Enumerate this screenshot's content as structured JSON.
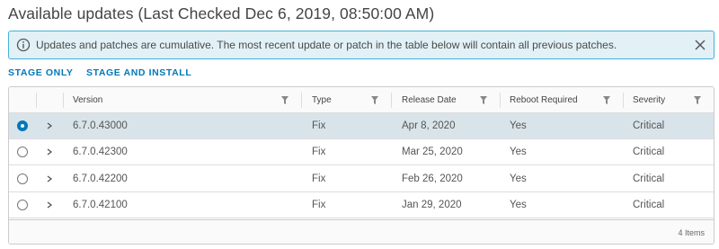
{
  "title": "Available updates (Last Checked Dec 6, 2019, 08:50:00 AM)",
  "alert": {
    "message": "Updates and patches are cumulative. The most recent update or patch in the table below will contain all previous patches.",
    "icon": "info-icon",
    "close_icon": "close-icon"
  },
  "actions": {
    "stage_only": "STAGE ONLY",
    "stage_and_install": "STAGE AND INSTALL"
  },
  "table": {
    "columns": [
      "Version",
      "Type",
      "Release Date",
      "Reboot Required",
      "Severity"
    ],
    "rows": [
      {
        "version": "6.7.0.43000",
        "type": "Fix",
        "release_date": "Apr 8, 2020",
        "reboot": "Yes",
        "severity": "Critical",
        "selected": true
      },
      {
        "version": "6.7.0.42300",
        "type": "Fix",
        "release_date": "Mar 25, 2020",
        "reboot": "Yes",
        "severity": "Critical",
        "selected": false
      },
      {
        "version": "6.7.0.42200",
        "type": "Fix",
        "release_date": "Feb 26, 2020",
        "reboot": "Yes",
        "severity": "Critical",
        "selected": false
      },
      {
        "version": "6.7.0.42100",
        "type": "Fix",
        "release_date": "Jan 29, 2020",
        "reboot": "Yes",
        "severity": "Critical",
        "selected": false
      }
    ],
    "footer": "4 Items"
  },
  "colors": {
    "accent": "#0079b8",
    "alert_bg": "#e1f1f6",
    "alert_border": "#49afd9",
    "selected_row": "#d9e4ea"
  }
}
